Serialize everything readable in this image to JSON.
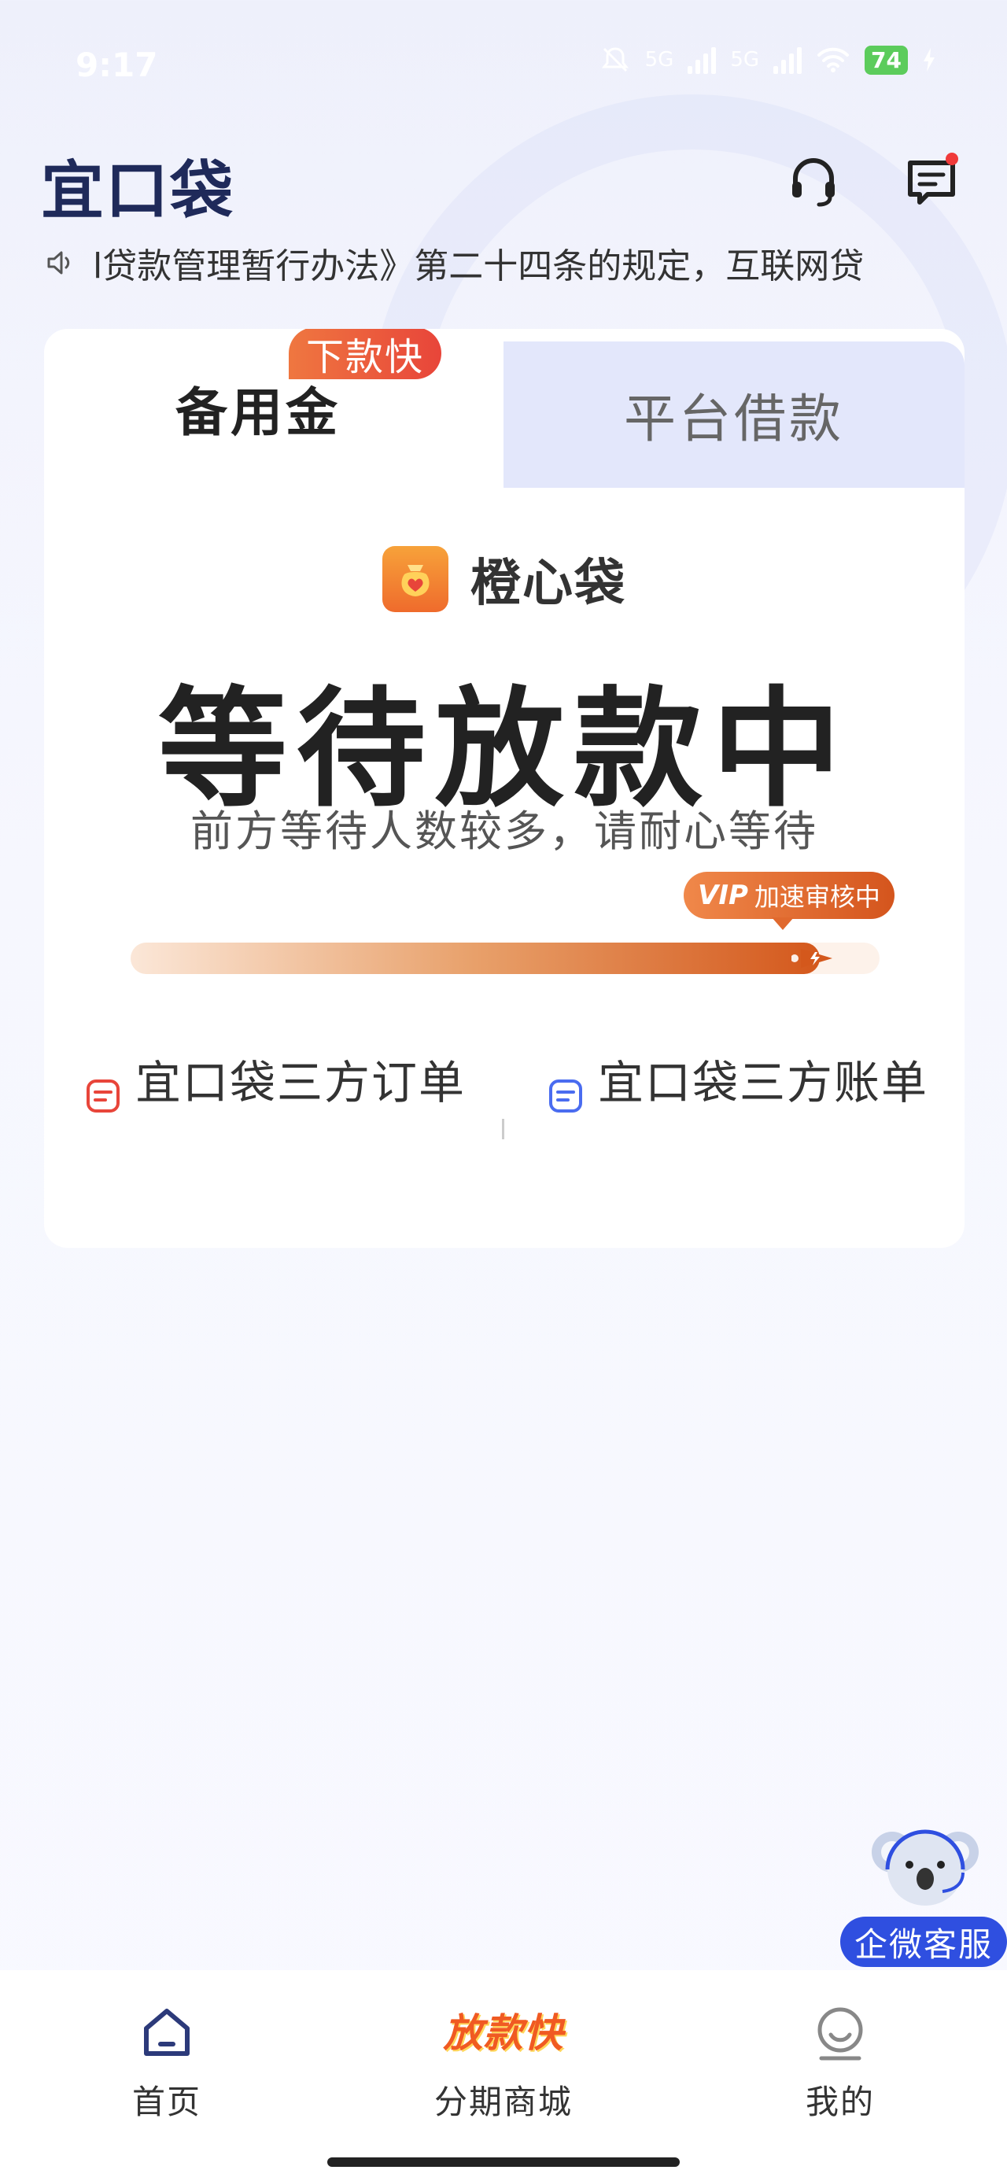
{
  "status_bar": {
    "time": "9:17",
    "network_1": "5G",
    "network_2": "5G",
    "battery": "74"
  },
  "header": {
    "logo": "宜口袋"
  },
  "notice": {
    "text": "l贷款管理暂行办法》第二十四条的规定，互联网贷"
  },
  "tabs": {
    "left_label": "备用金",
    "left_tag": "下款快",
    "right_label": "平台借款"
  },
  "lender": {
    "name": "橙心袋"
  },
  "status": {
    "title": "等待放款中",
    "subtitle": "前方等待人数较多，请耐心等待",
    "vip_prefix": "VIP",
    "vip_label": "加速审核中",
    "progress_fraction": 0.92
  },
  "links": {
    "orders": "宜口袋三方订单",
    "accounts": "宜口袋三方账单"
  },
  "float_service": {
    "label": "企微客服"
  },
  "bottom_nav": {
    "home": "首页",
    "mall_badge": "放款快",
    "mall": "分期商城",
    "mine": "我的"
  },
  "colors": {
    "brand": "#1f2a5a",
    "accent_orange": "#e8682a",
    "tab_inactive_bg": "#e3e7fb",
    "service_blue": "#2f4fe0"
  }
}
